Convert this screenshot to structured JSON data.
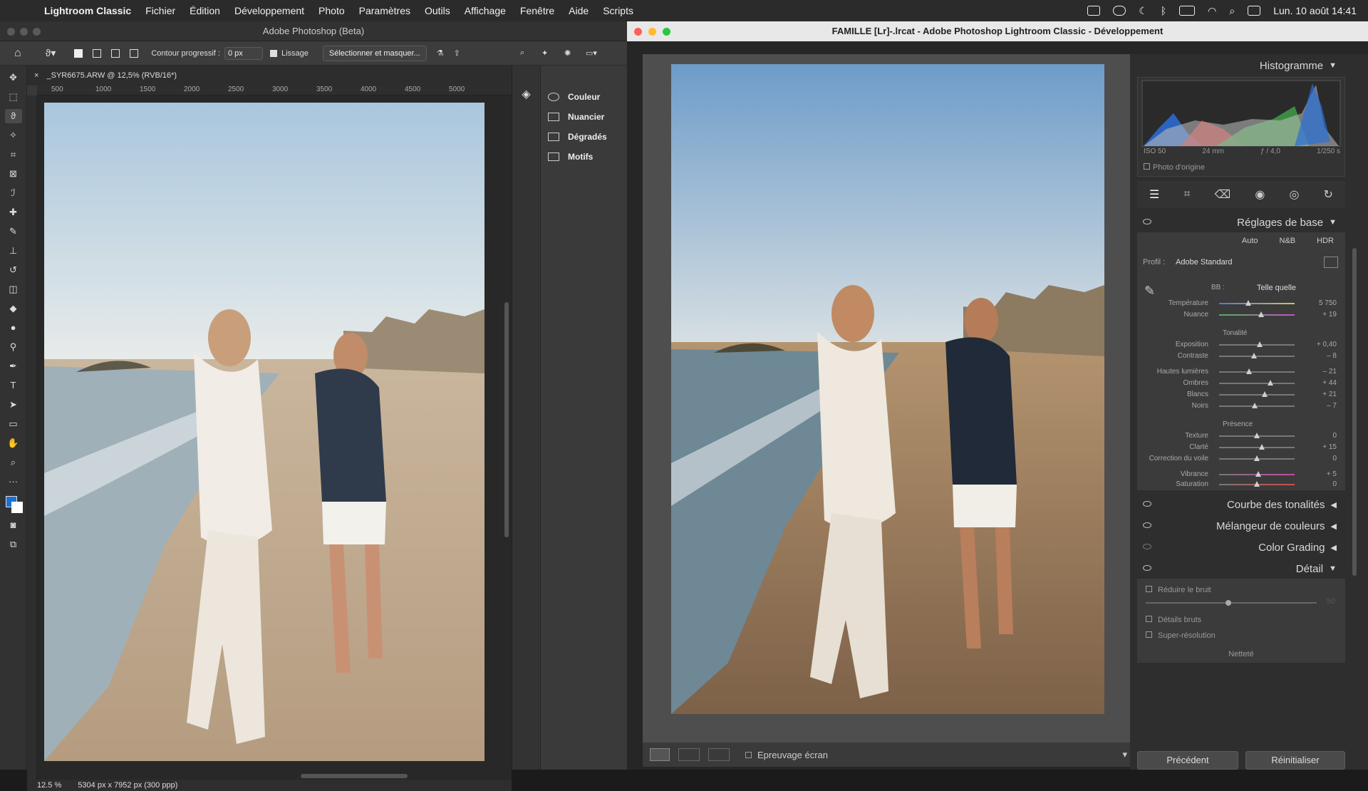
{
  "menubar": {
    "app": "Lightroom Classic",
    "items": [
      "Fichier",
      "Édition",
      "Développement",
      "Photo",
      "Paramètres",
      "Outils",
      "Affichage",
      "Fenêtre",
      "Aide",
      "Scripts"
    ],
    "datetime": "Lun. 10 août  14:41"
  },
  "photoshop": {
    "title": "Adobe Photoshop (Beta)",
    "options": {
      "contour_label": "Contour progressif :",
      "contour_value": "0 px",
      "lissage": "Lissage",
      "select_mask": "Sélectionner et masquer..."
    },
    "doc_tab": "_SYR6675.ARW @ 12,5% (RVB/16*)",
    "ruler": [
      "500",
      "1000",
      "1500",
      "2000",
      "2500",
      "3000",
      "3500",
      "4000",
      "4500",
      "5000"
    ],
    "panel": [
      "Couleur",
      "Nuancier",
      "Dégradés",
      "Motifs"
    ],
    "status": {
      "zoom": "12.5 %",
      "size": "5304 px x 7952 px (300 ppp)"
    }
  },
  "lightroom": {
    "title": "FAMILLE  [Lr]-.lrcat - Adobe Photoshop Lightroom Classic - Développement",
    "histogram": {
      "title": "Histogramme",
      "iso": "ISO 50",
      "focal": "24 mm",
      "aperture": "ƒ / 4,0",
      "shutter": "1/250 s",
      "origin": "Photo d'origine"
    },
    "basic": {
      "title": "Réglages de base",
      "auto": "Auto",
      "nb": "N&B",
      "hdr": "HDR",
      "profile_label": "Profil :",
      "profile_value": "Adobe Standard",
      "wb_label": "BB :",
      "wb_value": "Telle quelle",
      "temp": {
        "label": "Température",
        "value": "5 750",
        "pos": 0.39
      },
      "tint": {
        "label": "Nuance",
        "value": "+ 19",
        "pos": 0.56
      },
      "tonality": "Tonalité",
      "tone": [
        {
          "label": "Exposition",
          "value": "+ 0,40",
          "pos": 0.54
        },
        {
          "label": "Contraste",
          "value": "– 8",
          "pos": 0.46
        }
      ],
      "tone2": [
        {
          "label": "Hautes lumières",
          "value": "– 21",
          "pos": 0.4
        },
        {
          "label": "Ombres",
          "value": "+ 44",
          "pos": 0.68
        },
        {
          "label": "Blancs",
          "value": "+ 21",
          "pos": 0.6
        },
        {
          "label": "Noirs",
          "value": "– 7",
          "pos": 0.47
        }
      ],
      "presence": "Présence",
      "pres": [
        {
          "label": "Texture",
          "value": "0",
          "pos": 0.5
        },
        {
          "label": "Clarté",
          "value": "+ 15",
          "pos": 0.57
        },
        {
          "label": "Correction du voile",
          "value": "0",
          "pos": 0.5
        }
      ],
      "pres2": [
        {
          "label": "Vibrance",
          "value": "+ 5",
          "pos": 0.52
        },
        {
          "label": "Saturation",
          "value": "0",
          "pos": 0.5
        }
      ]
    },
    "collapsed": [
      "Courbe des tonalités",
      "Mélangeur de couleurs",
      "Color Grading"
    ],
    "detail": {
      "title": "Détail",
      "noise": "Réduire le bruit",
      "noise_value": "50",
      "raw": "Détails bruts",
      "superres": "Super-résolution",
      "sharpen": "Netteté"
    },
    "bottom": {
      "proof": "Epreuvage écran",
      "prev": "Précédent",
      "reset": "Réinitialiser"
    }
  }
}
